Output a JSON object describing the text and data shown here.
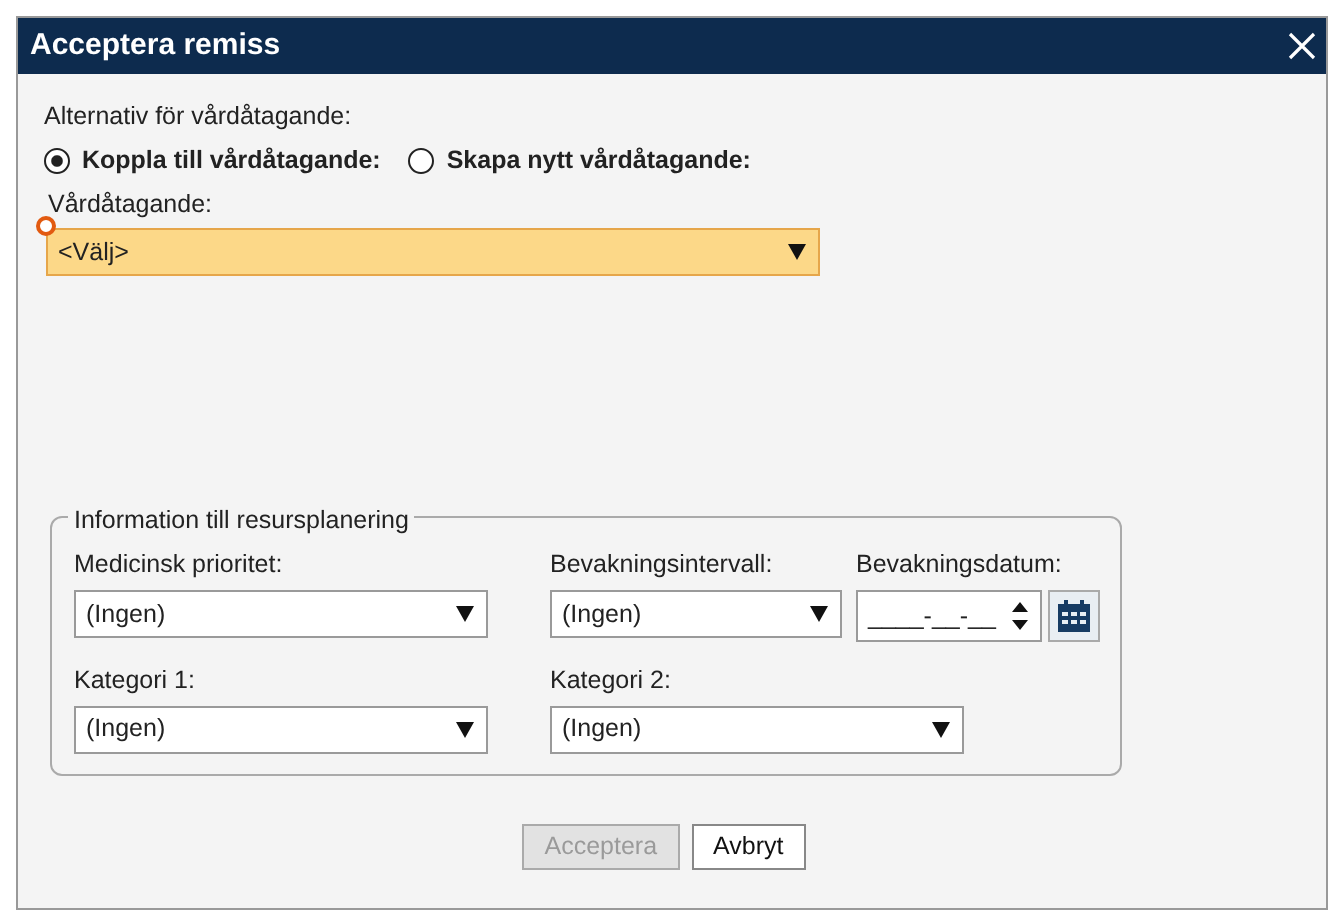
{
  "window": {
    "title": "Acceptera remiss"
  },
  "care_option": {
    "label": "Alternativ för vårdåtagande:",
    "options": [
      {
        "label": "Koppla till vårdåtagande:",
        "selected": true
      },
      {
        "label": "Skapa nytt vårdåtagande:",
        "selected": false
      }
    ]
  },
  "care_field": {
    "label": "Vårdåtagande:",
    "value": "<Välj>",
    "required": true
  },
  "resource_group": {
    "title": "Information till resursplanering",
    "rows": [
      [
        {
          "kind": "select",
          "label": "Medicinsk prioritet:",
          "value": "(Ingen)"
        },
        {
          "kind": "select",
          "label": "Bevakningsintervall:",
          "value": "(Ingen)"
        },
        {
          "kind": "date",
          "label": "Bevakningsdatum:",
          "value": "____-__-__"
        }
      ],
      [
        {
          "kind": "select",
          "label": "Kategori 1:",
          "value": "(Ingen)"
        },
        {
          "kind": "select",
          "label": "Kategori 2:",
          "value": "(Ingen)"
        }
      ]
    ]
  },
  "buttons": [
    {
      "label": "Acceptera",
      "disabled": true
    },
    {
      "label": "Avbryt",
      "disabled": false
    }
  ]
}
